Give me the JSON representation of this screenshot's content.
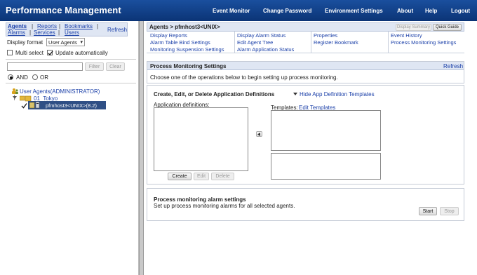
{
  "header": {
    "title": "Performance Management",
    "nav": [
      "Event Monitor",
      "Change Password",
      "Environment Settings",
      "About",
      "Help",
      "Logout"
    ]
  },
  "left": {
    "tabs_row1": [
      "Agents",
      "Reports",
      "Bookmarks"
    ],
    "tabs_row2": [
      "Alarms",
      "Services",
      "Users"
    ],
    "refresh": "Refresh",
    "display_format_label": "Display format",
    "display_format_value": "User Agents",
    "multi_select_label": "Multi select",
    "update_auto_label": "Update automatically",
    "filter_label": "Filter",
    "clear_label": "Clear",
    "and_label": "AND",
    "or_label": "OR",
    "tree": {
      "root": "User Agents(ADMINISTRATOR)",
      "group": "01_Tokyo",
      "agent": "pfmhost3<UNIX>(8.2)"
    }
  },
  "right": {
    "breadcrumb": "Agents > pfmhost3<UNIX>",
    "display_summary": "Display Summary",
    "quick_guide": "Quick Guide",
    "menu": [
      [
        "Display Reports",
        "Display Alarm Status",
        "Properties",
        "Event History"
      ],
      [
        "Alarm Table Bind Settings",
        "Edit Agent Tree",
        "Register Bookmark",
        "Process Monitoring Settings"
      ],
      [
        "Monitoring Suspension Settings",
        "Alarm Application Status",
        "",
        ""
      ]
    ],
    "pms_title": "Process Monitoring Settings",
    "pms_refresh": "Refresh",
    "pms_instruction": "Choose one of the operations below to begin setting up process monitoring.",
    "cede_title": "Create, Edit, or Delete Application Definitions",
    "hide_templates": "Hide App Definition Templates",
    "app_defs_label": "Application definitions:",
    "templates_label": "Templates:",
    "edit_templates": "Edit Templates",
    "create": "Create",
    "edit": "Edit",
    "delete": "Delete",
    "alarm_title": "Process monitoring alarm settings",
    "alarm_desc": "Set up process monitoring alarms for all selected agents.",
    "start": "Start",
    "stop": "Stop"
  }
}
